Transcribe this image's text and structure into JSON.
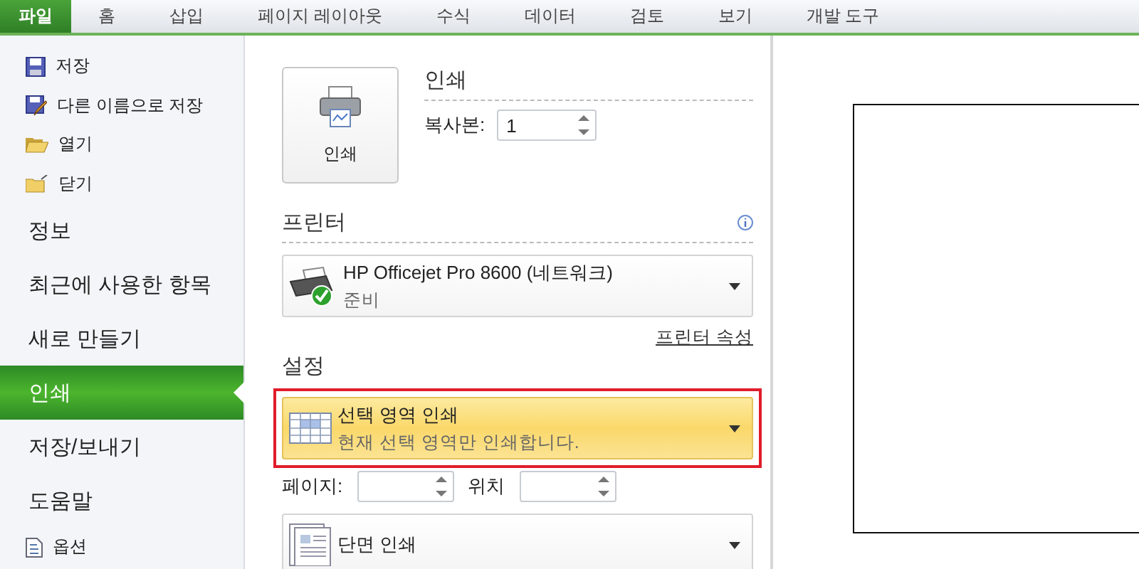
{
  "ribbon_tabs": [
    {
      "label": "파일",
      "selected": true
    },
    {
      "label": "홈",
      "selected": false
    },
    {
      "label": "삽입",
      "selected": false
    },
    {
      "label": "페이지 레이아웃",
      "selected": false
    },
    {
      "label": "수식",
      "selected": false
    },
    {
      "label": "데이터",
      "selected": false
    },
    {
      "label": "검토",
      "selected": false
    },
    {
      "label": "보기",
      "selected": false
    },
    {
      "label": "개발 도구",
      "selected": false
    }
  ],
  "sidebar": {
    "items": [
      {
        "label": "저장",
        "kind": "save",
        "selected": false
      },
      {
        "label": "다른 이름으로 저장",
        "kind": "saveas",
        "selected": false
      },
      {
        "label": "열기",
        "kind": "open",
        "selected": false
      },
      {
        "label": "닫기",
        "kind": "close",
        "selected": false
      },
      {
        "label": "정보",
        "kind": "section",
        "selected": false
      },
      {
        "label": "최근에 사용한 항목",
        "kind": "section",
        "selected": false
      },
      {
        "label": "새로 만들기",
        "kind": "section",
        "selected": false
      },
      {
        "label": "인쇄",
        "kind": "section",
        "selected": true
      },
      {
        "label": "저장/보내기",
        "kind": "section",
        "selected": false
      },
      {
        "label": "도움말",
        "kind": "section",
        "selected": false
      },
      {
        "label": "옵션",
        "kind": "options",
        "selected": false
      }
    ]
  },
  "print": {
    "button_label": "인쇄",
    "heading": "인쇄",
    "copies_label": "복사본:",
    "copies_value": "1"
  },
  "printer": {
    "heading": "프린터",
    "name": "HP Officejet Pro 8600 (네트워크)",
    "status": "준비",
    "properties_link": "프린터 속성"
  },
  "settings": {
    "heading": "설정",
    "options": [
      {
        "title": "선택 영역 인쇄",
        "description": "현재 선택 영역만 인쇄합니다.",
        "kind": "table",
        "highlighted": true
      },
      {
        "title": "단면 인쇄",
        "kind": "pages",
        "highlighted": false
      }
    ],
    "pages_label": "페이지:",
    "to_label": "위치"
  }
}
